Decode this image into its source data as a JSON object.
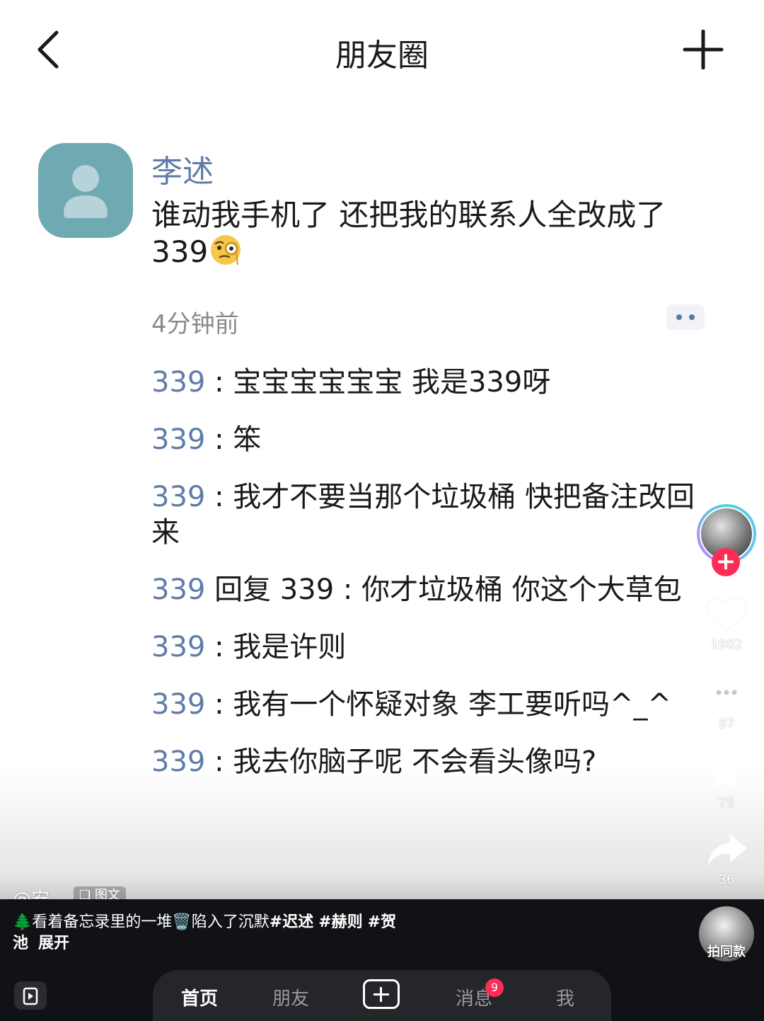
{
  "header": {
    "title": "朋友圈"
  },
  "post": {
    "author": "李述",
    "text": "谁动我手机了 还把我的联系人全改成了339",
    "emoji": "monocle-face",
    "time": "4分钟前"
  },
  "comments": [
    {
      "name": "339",
      "sep": " : ",
      "text": "宝宝宝宝宝宝 我是339呀"
    },
    {
      "name": "339",
      "sep": " : ",
      "text": "笨"
    },
    {
      "name": "339",
      "sep": " : ",
      "text": "我才不要当那个垃圾桶 快把备注改回来"
    },
    {
      "name": "339",
      "sep": " 回复 ",
      "reply_to": "339",
      "sep2": " : ",
      "text": "你才垃圾桶 你这个大草包"
    },
    {
      "name": "339",
      "sep": " : ",
      "text": "我是许则"
    },
    {
      "name": "339",
      "sep": " : ",
      "text": "我有一个怀疑对象 李工要听吗^_^"
    },
    {
      "name": "339",
      "sep": " : ",
      "text": "我去你脑子呢 不会看头像吗?"
    }
  ],
  "rail": {
    "likes": "1902",
    "comments": "97",
    "favorites": "75",
    "shares": "36",
    "follow": "+"
  },
  "caption": {
    "author": "@安。",
    "type_tag": "图文",
    "line1_prefix": "🌲看着备忘录里的一堆🗑️陷入了沉默",
    "tags": [
      "#迟述",
      "#赫则",
      "#贺"
    ],
    "line2_tag_rest": "池",
    "expand": "展开",
    "same_style": "拍同款"
  },
  "nav": {
    "home": "首页",
    "friends": "朋友",
    "messages": "消息",
    "messages_badge": "9",
    "me": "我"
  },
  "colors": {
    "name_blue": "#5f7ca6",
    "avatar_teal": "#6fa9b2",
    "badge_red": "#fe2c55"
  }
}
